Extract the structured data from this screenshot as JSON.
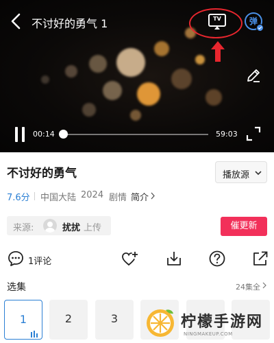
{
  "player": {
    "title": "不讨好的勇气 1",
    "tv_label": "TV",
    "danmaku_label": "弹",
    "time_current": "00:14",
    "time_total": "59:03",
    "progress_fraction": 0.01
  },
  "show": {
    "title": "不讨好的勇气",
    "source_button_label": "播放源",
    "rating": "7.6分",
    "region": "中国大陆",
    "year": "2024",
    "genre": "剧情",
    "intro_label": "简介"
  },
  "uploader": {
    "prefix": "来源:",
    "name": "扰扰",
    "suffix": "上传"
  },
  "urge_button_label": "催更新",
  "actions": {
    "comment_count": "1评论"
  },
  "episodes": {
    "label": "选集",
    "total": "24集全",
    "items": [
      "1",
      "2",
      "3"
    ],
    "selected": "1"
  },
  "watermark": {
    "text": "柠檬手游网",
    "sub": "NINGMAKEUP.COM"
  },
  "colors": {
    "accent_blue": "#2a7fd4",
    "urge_pink": "#f2305a",
    "highlight_red": "#e8262e"
  }
}
